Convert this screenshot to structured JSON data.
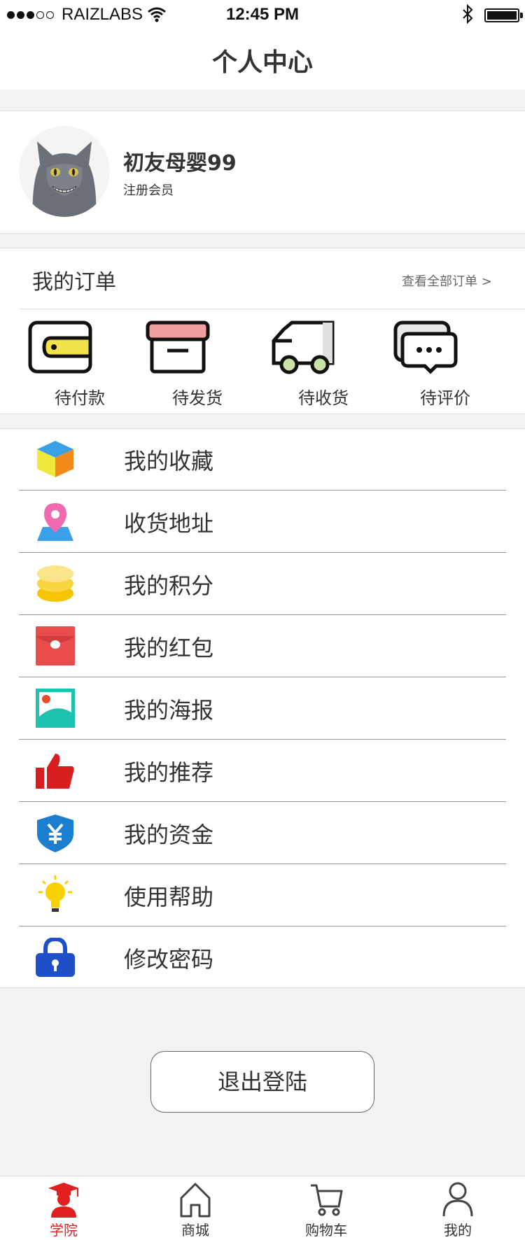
{
  "status_bar": {
    "carrier": "RAIZLABS",
    "time": "12:45 PM",
    "signal_bars_filled": 3,
    "signal_bars_total": 5
  },
  "header": {
    "title": "个人中心"
  },
  "profile": {
    "username": "初友母婴99",
    "member_label": "注册会员"
  },
  "orders": {
    "title": "我的订单",
    "view_all": "查看全部订单 >",
    "items": [
      {
        "label": "待付款",
        "icon": "wallet-icon"
      },
      {
        "label": "待发货",
        "icon": "box-icon"
      },
      {
        "label": "待收货",
        "icon": "truck-icon"
      },
      {
        "label": "待评价",
        "icon": "chat-icon"
      }
    ]
  },
  "menu": {
    "items": [
      {
        "label": "我的收藏",
        "icon": "cube-icon"
      },
      {
        "label": "收货地址",
        "icon": "map-pin-icon"
      },
      {
        "label": "我的积分",
        "icon": "coins-icon"
      },
      {
        "label": "我的红包",
        "icon": "red-envelope-icon"
      },
      {
        "label": "我的海报",
        "icon": "poster-icon"
      },
      {
        "label": "我的推荐",
        "icon": "thumbs-up-icon"
      },
      {
        "label": "我的资金",
        "icon": "yuan-shield-icon"
      },
      {
        "label": "使用帮助",
        "icon": "lightbulb-icon"
      },
      {
        "label": "修改密码",
        "icon": "lock-icon"
      }
    ]
  },
  "logout": {
    "label": "退出登陆"
  },
  "tabbar": {
    "tabs": [
      {
        "label": "学院",
        "icon": "graduate-icon",
        "active": true
      },
      {
        "label": "商城",
        "icon": "home-icon",
        "active": false
      },
      {
        "label": "购物车",
        "icon": "cart-icon",
        "active": false
      },
      {
        "label": "我的",
        "icon": "person-icon",
        "active": false
      }
    ]
  },
  "colors": {
    "text_primary": "#333333",
    "text_secondary": "#666666",
    "divider": "#999999",
    "background": "#f2f2f2",
    "accent_red": "#e02020"
  }
}
